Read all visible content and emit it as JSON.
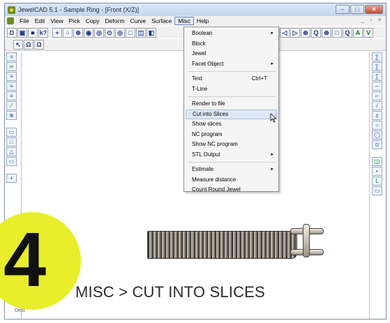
{
  "window": {
    "title": "JewelCAD 5.1 - Sample Ring - [Front (X/Z)]"
  },
  "title_controls": [
    "–",
    "□",
    "✕"
  ],
  "menubar": {
    "items": [
      "File",
      "Edit",
      "View",
      "Pick",
      "Copy",
      "Deform",
      "Curve",
      "Surface",
      "Misc",
      "Help"
    ],
    "active": "Misc"
  },
  "mdi_controls": [
    "_",
    "▫",
    "×"
  ],
  "toolbar1": [
    "D",
    "▣",
    "■",
    "k?",
    "+",
    "○",
    "⊕",
    "◉",
    "◎",
    "⊙",
    "◎",
    "□",
    "◫",
    "◧"
  ],
  "toolbar1_right": [
    "?",
    "◁",
    "▷",
    "⊕",
    "Q",
    "⊗",
    "□",
    "Q",
    "A",
    "V"
  ],
  "toolbar2": [
    "↖",
    "Ω",
    "Ω"
  ],
  "left_tools": [
    "≡",
    "∞",
    "≡",
    "≡",
    "≡",
    "⁄",
    "⊕",
    "▭",
    "□",
    "△",
    "▭",
    "+"
  ],
  "right_tools": [
    "∑",
    "∑",
    "∑",
    "⌐",
    "⌐",
    "/",
    "±",
    "○",
    "◯",
    "⊙",
    "◫",
    "•",
    "L",
    "▭"
  ],
  "misc_menu": {
    "items": [
      {
        "label": "Boolean",
        "submenu": true
      },
      {
        "label": "Block"
      },
      {
        "label": "Jewel"
      },
      {
        "label": "Facet Object",
        "submenu": true
      },
      {
        "separator": true
      },
      {
        "label": "Text",
        "shortcut": "Ctrl+T"
      },
      {
        "label": "T-Line"
      },
      {
        "separator": true
      },
      {
        "label": "Render to file"
      },
      {
        "label": "Cut into Slices",
        "highlighted": true
      },
      {
        "label": "Show slices"
      },
      {
        "label": "NC program"
      },
      {
        "label": "Show NC program"
      },
      {
        "label": "STL Output",
        "submenu": true
      },
      {
        "separator": true
      },
      {
        "label": "Estimate",
        "submenu": true
      },
      {
        "label": "Measure distance"
      },
      {
        "label": "Count Round Jewel"
      }
    ]
  },
  "overlay": {
    "step_number": "4",
    "caption": "MISC > CUT INTO SLICES"
  },
  "status": {
    "text": "Dest"
  }
}
